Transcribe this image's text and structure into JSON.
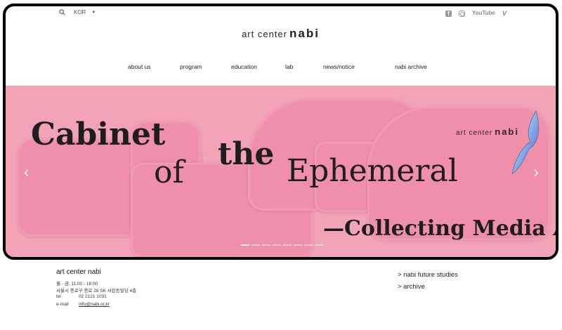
{
  "top": {
    "lang_label": "KOR",
    "social": [
      "facebook-icon",
      "instagram-icon",
      "youtube-icon",
      "vimeo-icon"
    ],
    "youtube_text": "YouTube",
    "vimeo_text": "V"
  },
  "logo": {
    "light": "art center",
    "bold": "nabi"
  },
  "nav": [
    {
      "label": "about us"
    },
    {
      "label": "program"
    },
    {
      "label": "education"
    },
    {
      "label": "lab"
    },
    {
      "label": "news/notice"
    },
    {
      "label": "nabi archive"
    }
  ],
  "hero": {
    "line1": "Cabinet",
    "line2": "of",
    "line3": "the",
    "line4": "Ephemeral",
    "line5": "—Collecting Media Art",
    "brand_light": "art center",
    "brand_bold": "nabi",
    "slide_count": 8,
    "active_slide": 1,
    "colors": {
      "background": "#f2a4b6",
      "blob": "#ef8fa9",
      "text": "#1e1e1e"
    }
  },
  "footer": {
    "name": "art center nabi",
    "hours": "월 - 금, 11:00 - 18:00",
    "address": "서울시 종로구 종로 26 SK 서린동빌딩 4층",
    "tel_label": "tel",
    "tel_value": "02 2121 1031",
    "email_label": "e-mail",
    "email_value": "info@nabi.or.kr",
    "links": [
      "> nabi future studies",
      "> archive"
    ]
  }
}
